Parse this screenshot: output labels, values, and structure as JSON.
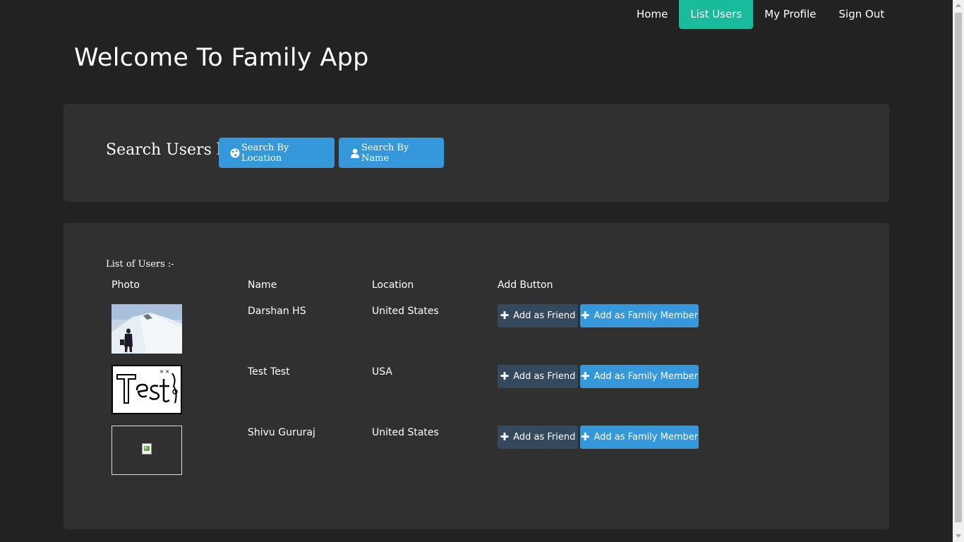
{
  "nav": {
    "items": [
      {
        "label": "Home"
      },
      {
        "label": "List Users",
        "active": true
      },
      {
        "label": "My Profile"
      },
      {
        "label": "Sign Out"
      }
    ],
    "active_color": "#18bc9c"
  },
  "page_title": "Welcome To Family App",
  "search": {
    "label": "Search Users by",
    "by_location_label": "Search By Location",
    "by_location_icon": "globe-icon",
    "by_name_label": "Search By Name",
    "by_name_icon": "user-icon"
  },
  "list": {
    "caption": "List of Users :-",
    "headers": {
      "photo": "Photo",
      "name": "Name",
      "location": "Location",
      "add": "Add Button"
    },
    "users": [
      {
        "name": "Darshan HS",
        "location": "United States",
        "photo": "snow-mountain-photo"
      },
      {
        "name": "Test Test",
        "location": "USA",
        "photo": "test-sketch-photo"
      },
      {
        "name": "Shivu Gururaj",
        "location": "United States",
        "photo": "broken-image"
      }
    ],
    "friend_button_label": "Add as Friend",
    "family_button_label": "Add as Family Member"
  },
  "colors": {
    "background": "#222222",
    "panel": "#303030",
    "primary": "#3498db",
    "dark_button": "#34495e"
  }
}
